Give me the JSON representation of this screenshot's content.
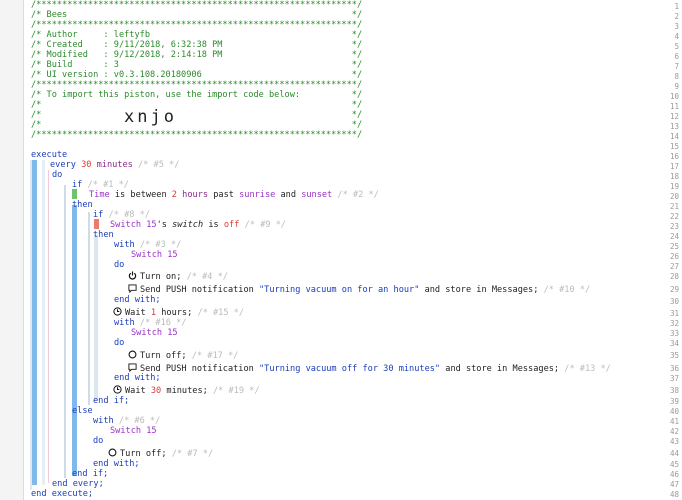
{
  "header_lines": [
    "/**************************************************************/",
    "/* Bees                                                       */",
    "/**************************************************************/",
    "/* Author     : leftyfb                                       */",
    "/* Created    : 9/11/2018, 6:32:38 PM                         */",
    "/* Modified   : 9/12/2018, 2:14:18 PM                         */",
    "/* Build      : 3                                             */",
    "/* UI version : v0.3.108.20180906                             */",
    "/**************************************************************/",
    "/* To import this piston, use the import code below:          */",
    "/*                                                            */",
    "/*                                                            */",
    "/*                                                            */",
    "/**************************************************************/"
  ],
  "import_code": "xnjo",
  "line_numbers": [
    "1",
    "2",
    "3",
    "4",
    "5",
    "6",
    "7",
    "8",
    "9",
    "10",
    "11",
    "12",
    "13",
    "14",
    "15",
    "16",
    "17",
    "18",
    "19",
    "20",
    "21",
    "22",
    "23",
    "24",
    "25",
    "26",
    "27",
    "28",
    "29",
    "30",
    "31",
    "32",
    "33",
    "34",
    "35",
    "36",
    "37",
    "38",
    "39",
    "40",
    "41",
    "42",
    "43",
    "44",
    "45",
    "46",
    "47",
    "48"
  ],
  "code": {
    "execute": "execute",
    "every": "every",
    "every_value": "30",
    "every_unit": "minutes",
    "every_comment": "/* #5 */",
    "do": "do",
    "if": "if",
    "if1_comment": "/* #1 */",
    "cond1_text_a": "Time",
    "cond1_text_b": " is between ",
    "cond1_val1": "2",
    "cond1_unit1": "hours",
    "cond1_text_c": " past ",
    "cond1_sunrise": "sunrise",
    "cond1_and": " and ",
    "cond1_sunset": "sunset",
    "cond1_comment": "/* #2 */",
    "then": "then",
    "if2_comment": "/* #8 */",
    "cond2_device": "Switch 15",
    "cond2_text_a": "'s ",
    "cond2_attr": "switch",
    "cond2_text_b": " is ",
    "cond2_value": "off",
    "cond2_comment": "/* #9 */",
    "with": "with",
    "with3_comment": "/* #3 */",
    "device": "Switch 15",
    "turn_on": "Turn on;",
    "turn_on_comment": "/* #4 */",
    "send_push": "Send PUSH notification ",
    "msg_on": "\"Turning vacuum on for an hour\"",
    "store": " and store in Messages;",
    "push1_comment": "/* #10 */",
    "end_with": "end with;",
    "wait": "Wait ",
    "wait1_value": "1",
    "wait1_unit": " hours;",
    "wait1_comment": "/* #15 */",
    "with16_comment": "/* #16 */",
    "turn_off": "Turn off;",
    "turn_off1_comment": "/* #17 */",
    "msg_off": "\"Turning vacuum off for 30 minutes\"",
    "push2_comment": "/* #13 */",
    "wait2_value": "30",
    "wait2_unit": " minutes;",
    "wait2_comment": "/* #19 */",
    "end_if": "end if;",
    "else": "else",
    "with6_comment": "/* #6 */",
    "turn_off2_comment": "/* #7 */",
    "end_every": "end every;",
    "end_execute": "end execute;"
  },
  "colors": {
    "comment": "#2c8a2c",
    "keyword": "#1a3dbb",
    "number": "#d63a3a",
    "device": "#9a32c8",
    "block_bar": "#7fb9ec",
    "condition_true": "#6cc46c",
    "condition_false": "#e87d6c"
  },
  "icons": {
    "power": "power-icon",
    "message": "message-icon",
    "clock": "clock-icon"
  }
}
